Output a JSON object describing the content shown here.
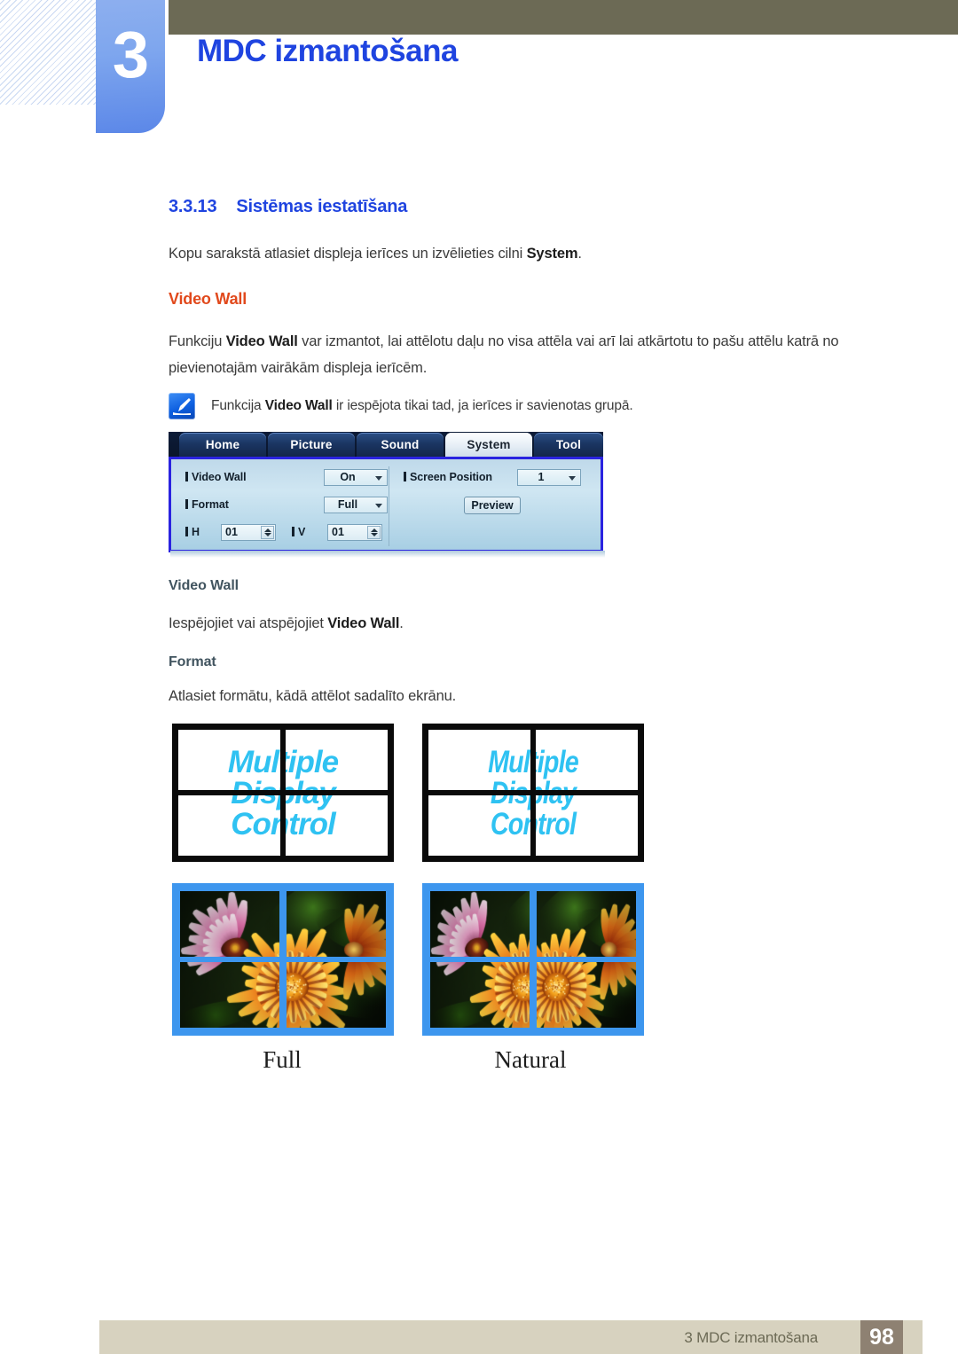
{
  "header": {
    "chapter_number": "3",
    "chapter_title": "MDC izmantošana"
  },
  "section": {
    "number": "3.3.13",
    "title": "Sistēmas iestatīšana",
    "intro_html": "Kopu sarakstā atlasiet displeja ierīces un izvēlieties cilni <b>System</b>."
  },
  "video_wall": {
    "heading": "Video Wall",
    "paragraph_html": "Funkciju <b>Video Wall</b> var izmantot, lai attēlotu daļu no visa attēla vai arī lai atkārtotu to pašu attēlu katrā no pievienotajām vairākām displeja ierīcēm.",
    "note_html": "Funkcija <b>Video Wall</b> ir iespējota tikai tad, ja ierīces ir savienotas grupā.",
    "note_icon": "note-pen-icon",
    "sub_heading": "Video Wall",
    "sub_paragraph_html": "Iespējojiet vai atspējojiet <b>Video Wall</b>."
  },
  "format": {
    "heading": "Format",
    "paragraph": "Atlasiet formātu, kādā attēlot sadalīto ekrānu.",
    "diagram_text": [
      "Multiple",
      "Display",
      "Control"
    ],
    "captions": [
      "Full",
      "Natural"
    ]
  },
  "mdc_panel": {
    "tabs": [
      {
        "label": "Home",
        "selected": false
      },
      {
        "label": "Picture",
        "selected": false
      },
      {
        "label": "Sound",
        "selected": false
      },
      {
        "label": "System",
        "selected": true
      },
      {
        "label": "Tool",
        "selected": false
      }
    ],
    "fields": {
      "video_wall_label": "Video Wall",
      "video_wall_value": "On",
      "format_label": "Format",
      "format_value": "Full",
      "h_label": "H",
      "h_value": "01",
      "v_label": "V",
      "v_value": "01",
      "screen_position_label": "Screen Position",
      "screen_position_value": "1",
      "preview_label": "Preview"
    }
  },
  "footer": {
    "text": "3 MDC izmantošana",
    "page": "98"
  },
  "colors": {
    "accent_blue": "#1f44e0",
    "orange": "#e1491c",
    "slate": "#41545f",
    "olive": "#6c6a55",
    "footer_bg": "#d7d2bf",
    "page_box": "#8e8172",
    "cyan_text": "#2fc2f2",
    "bezel_blue": "#3d96ee"
  }
}
